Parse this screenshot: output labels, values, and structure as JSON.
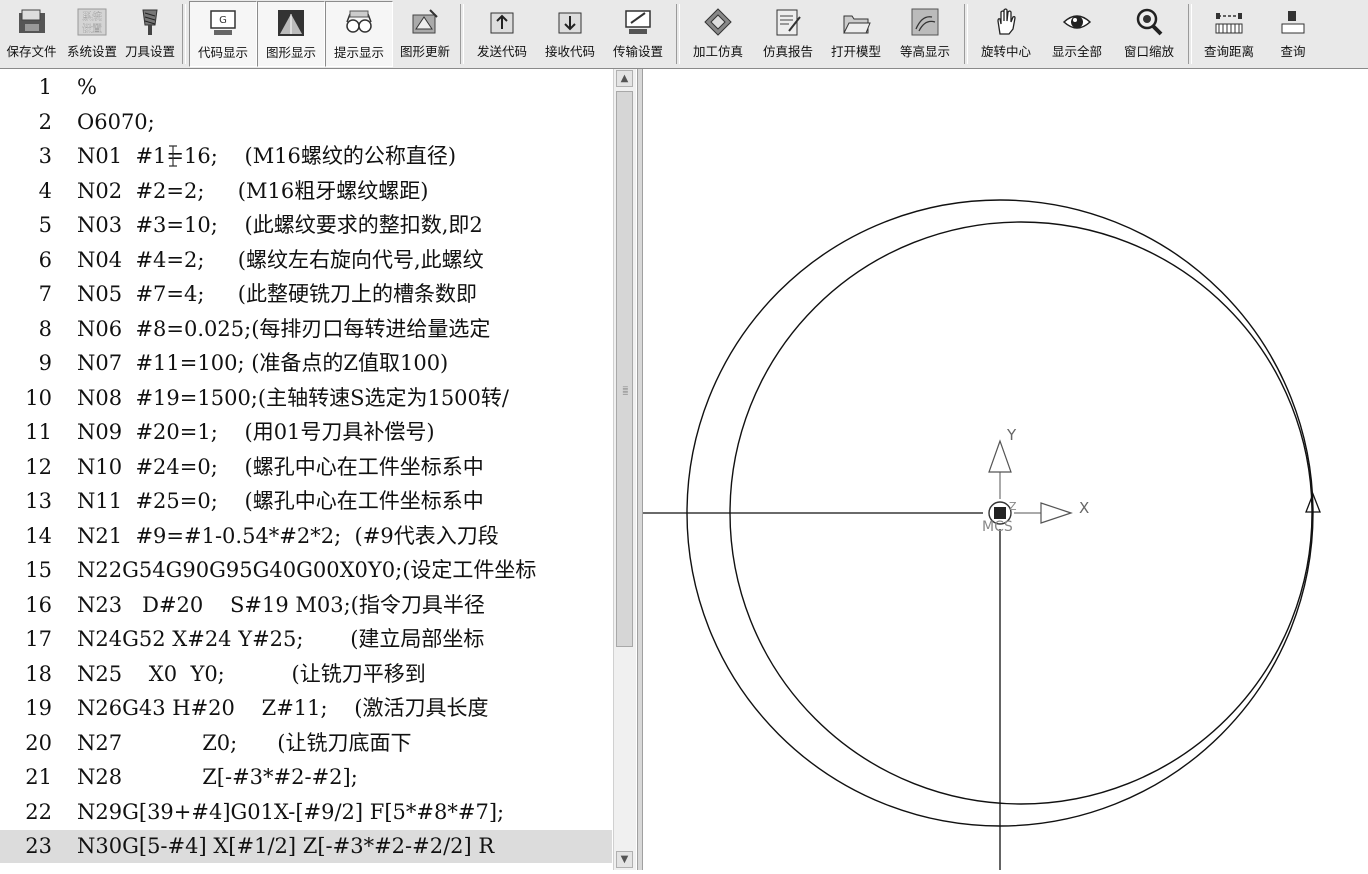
{
  "toolbar": {
    "groups": [
      [
        {
          "id": "save-file",
          "label": "保存文件",
          "icon": "save-icon"
        },
        {
          "id": "system-settings",
          "label": "系统设置",
          "icon": "system-settings-icon",
          "icon_text": "系统设置"
        },
        {
          "id": "tool-settings",
          "label": "刀具设置",
          "icon": "milling-cutter-icon"
        }
      ],
      [
        {
          "id": "code-display",
          "label": "代码显示",
          "icon": "code-monitor-icon",
          "pressed": true
        },
        {
          "id": "graphic-display",
          "label": "图形显示",
          "icon": "graphic-display-icon",
          "pressed": true
        },
        {
          "id": "hint-display",
          "label": "提示显示",
          "icon": "glasses-icon",
          "pressed": true
        },
        {
          "id": "graphic-update",
          "label": "图形更新",
          "icon": "graphic-update-icon"
        }
      ],
      [
        {
          "id": "send-code",
          "label": "发送代码",
          "icon": "send-code-icon"
        },
        {
          "id": "receive-code",
          "label": "接收代码",
          "icon": "receive-code-icon"
        },
        {
          "id": "transfer-settings",
          "label": "传输设置",
          "icon": "transfer-settings-icon"
        }
      ],
      [
        {
          "id": "machining-sim",
          "label": "加工仿真",
          "icon": "machining-sim-icon"
        },
        {
          "id": "sim-report",
          "label": "仿真报告",
          "icon": "sim-report-icon"
        },
        {
          "id": "open-model",
          "label": "打开模型",
          "icon": "open-folder-icon"
        },
        {
          "id": "contour-display",
          "label": "等高显示",
          "icon": "contour-icon"
        }
      ],
      [
        {
          "id": "rotate-center",
          "label": "旋转中心",
          "icon": "hand-icon"
        },
        {
          "id": "show-all",
          "label": "显示全部",
          "icon": "eye-icon"
        },
        {
          "id": "window-zoom",
          "label": "窗口缩放",
          "icon": "magnifier-icon"
        }
      ],
      [
        {
          "id": "query-distance",
          "label": "查询距离",
          "icon": "query-distance-icon"
        },
        {
          "id": "query-more",
          "label": "查询",
          "icon": "query-icon"
        }
      ]
    ]
  },
  "code": {
    "selected_line": 23,
    "lines": [
      {
        "n": "1",
        "t": "%"
      },
      {
        "n": "2",
        "t": "O6070;"
      },
      {
        "n": "3",
        "t": "N01  #1=16;    (M16螺纹的公称直径)"
      },
      {
        "n": "4",
        "t": "N02  #2=2;     (M16粗牙螺纹螺距)"
      },
      {
        "n": "5",
        "t": "N03  #3=10;    (此螺纹要求的整扣数,即2"
      },
      {
        "n": "6",
        "t": "N04  #4=2;     (螺纹左右旋向代号,此螺纹"
      },
      {
        "n": "7",
        "t": "N05  #7=4;     (此整硬铣刀上的槽条数即"
      },
      {
        "n": "8",
        "t": "N06  #8=0.025;(每排刃口每转进给量选定"
      },
      {
        "n": "9",
        "t": "N07  #11=100; (准备点的Z值取100)"
      },
      {
        "n": "10",
        "t": "N08  #19=1500;(主轴转速S选定为1500转/"
      },
      {
        "n": "11",
        "t": "N09  #20=1;    (用01号刀具补偿号)"
      },
      {
        "n": "12",
        "t": "N10  #24=0;    (螺孔中心在工件坐标系中"
      },
      {
        "n": "13",
        "t": "N11  #25=0;    (螺孔中心在工件坐标系中"
      },
      {
        "n": "14",
        "t": "N21  #9=#1-0.54*#2*2;  (#9代表入刀段"
      },
      {
        "n": "15",
        "t": "N22G54G90G95G40G00X0Y0;(设定工件坐标"
      },
      {
        "n": "16",
        "t": "N23   D#20    S#19 M03;(指令刀具半径"
      },
      {
        "n": "17",
        "t": "N24G52 X#24 Y#25;       (建立局部坐标"
      },
      {
        "n": "18",
        "t": "N25    X0  Y0;          (让铣刀平移到"
      },
      {
        "n": "19",
        "t": "N26G43 H#20    Z#11;    (激活刀具长度"
      },
      {
        "n": "20",
        "t": "N27            Z0;      (让铣刀底面下"
      },
      {
        "n": "21",
        "t": "N28            Z[-#3*#2-#2];"
      },
      {
        "n": "22",
        "t": "N29G[39+#4]G01X-[#9/2] F[5*#8*#7];"
      },
      {
        "n": "23",
        "t": "N30G[5-#4] X[#1/2] Z[-#3*#2-#2/2] R"
      }
    ]
  },
  "graphics": {
    "axis_x_label": "X",
    "axis_y_label": "Y",
    "axis_z_label": "Z",
    "origin_label": "MCS"
  }
}
